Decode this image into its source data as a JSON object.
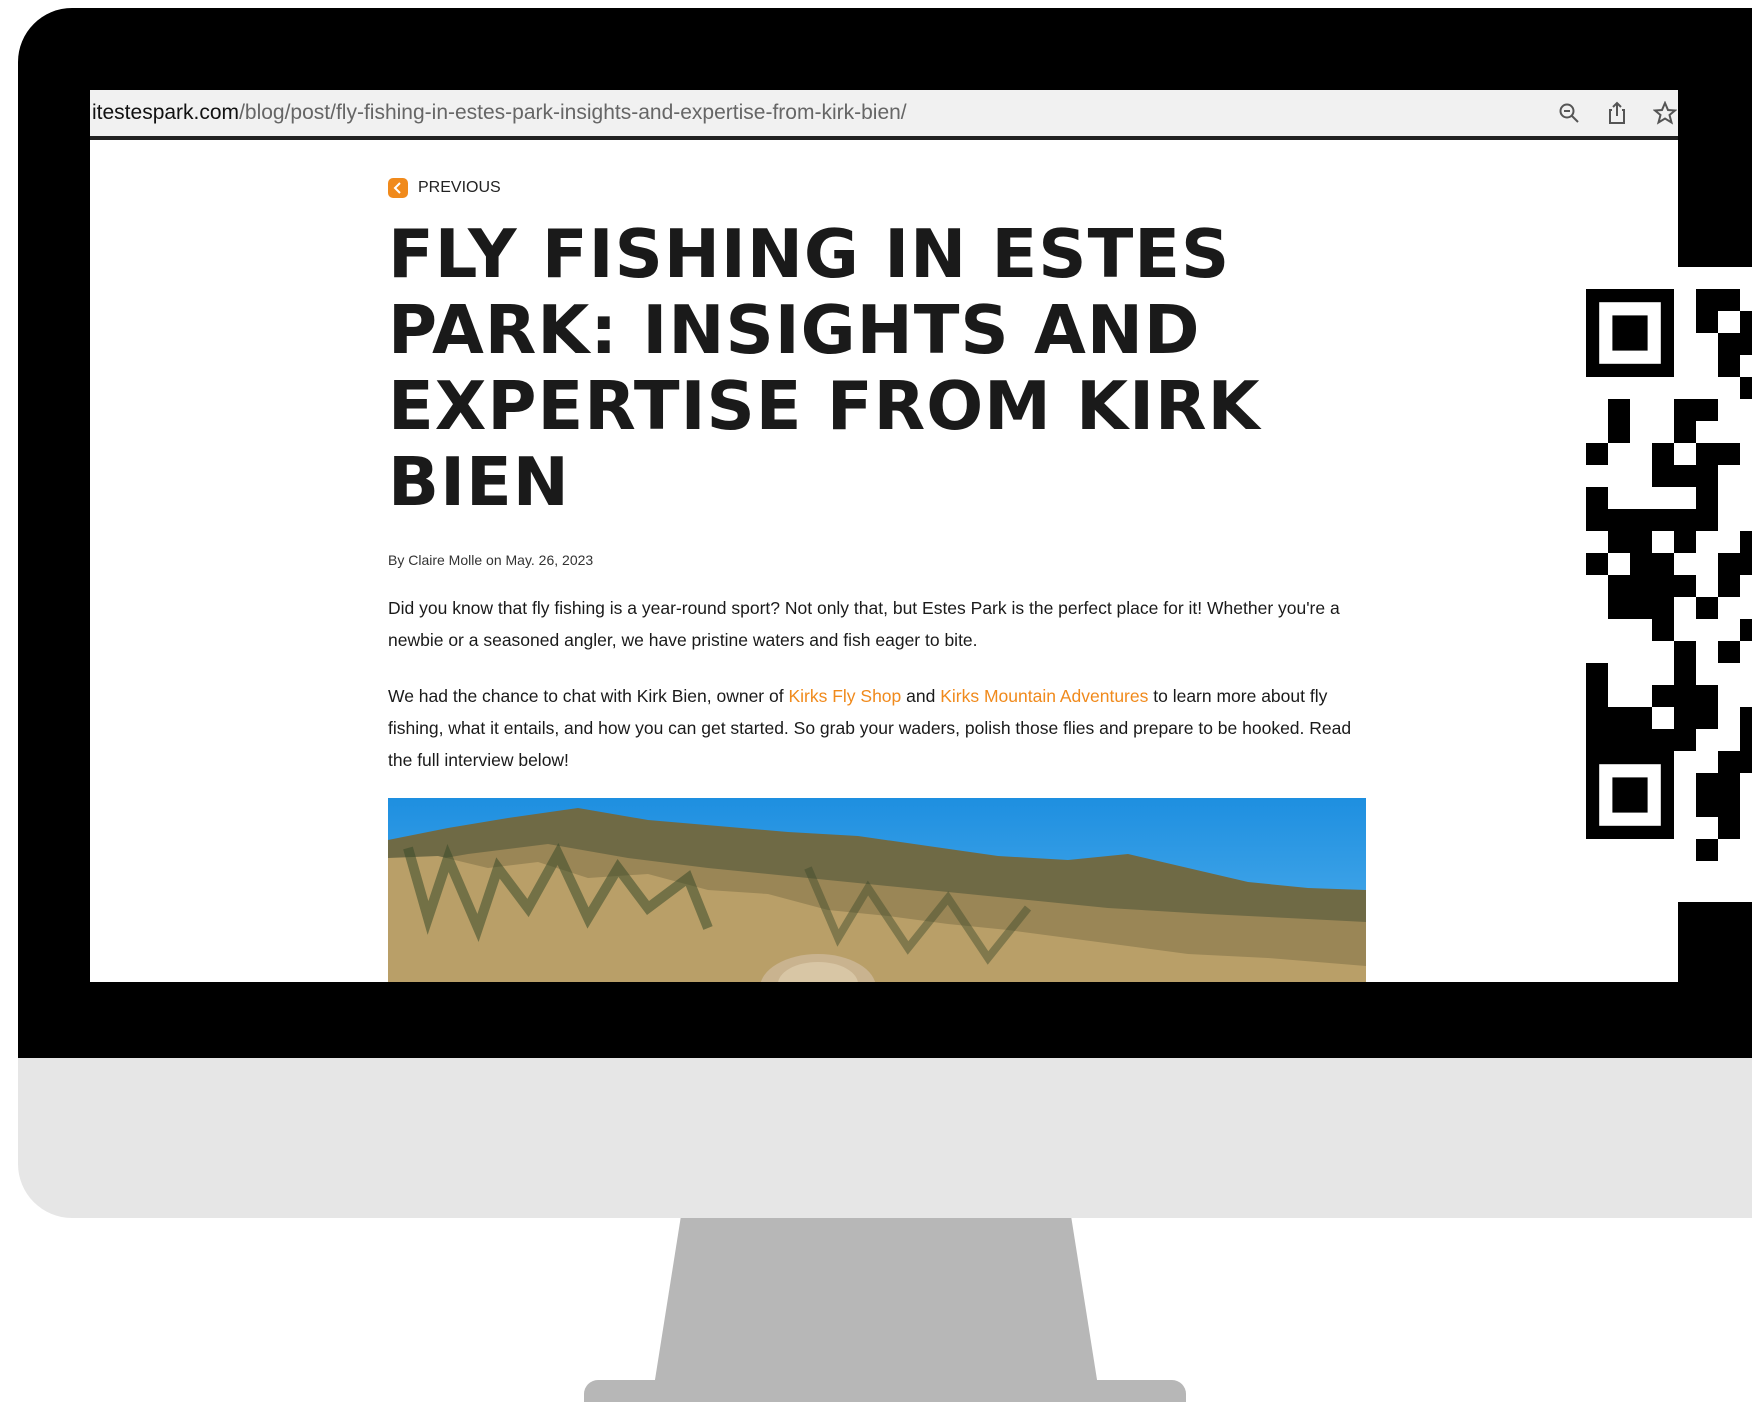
{
  "browser": {
    "url_domain": "itestespark.com",
    "url_path": "/blog/post/fly-fishing-in-estes-park-insights-and-expertise-from-kirk-bien/",
    "icons": [
      "zoom-icon",
      "share-icon",
      "bookmark-star-icon"
    ]
  },
  "article": {
    "previous_label": "PREVIOUS",
    "title": "FLY FISHING IN ESTES PARK: INSIGHTS AND EXPERTISE FROM KIRK BIEN",
    "byline": "By Claire Molle on May. 26, 2023",
    "para1": "Did you know that fly fishing is a year-round sport? Not only that, but Estes Park is the perfect place for it! Whether you're a newbie or a seasoned angler, we have pristine waters and fish eager to bite.",
    "para2_a": "We had the chance to chat with Kirk Bien, owner of ",
    "link1": "Kirks Fly Shop",
    "para2_b": " and ",
    "link2": "Kirks Mountain Adventures",
    "para2_c": " to learn more about fly fishing, what it entails, and how you can get started. So grab your waders, polish those flies and prepare to be hooked. Read the full interview below!"
  },
  "colors": {
    "accent": "#f08a1c",
    "bezel": "#000000",
    "chassis": "#e6e6e6",
    "stand": "#b7b7b7"
  }
}
